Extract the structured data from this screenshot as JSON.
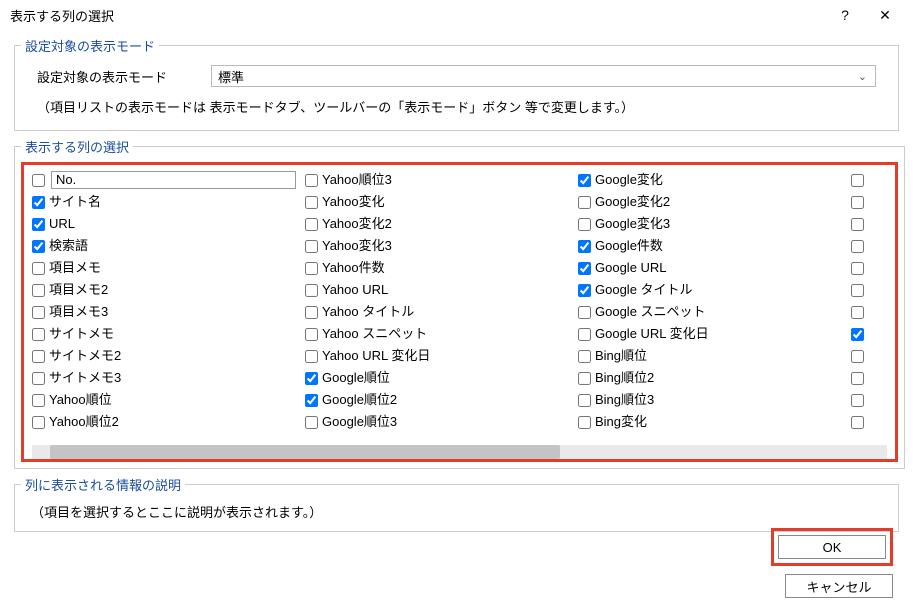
{
  "titlebar": {
    "title": "表示する列の選択",
    "help_icon": "?",
    "close_icon": "✕"
  },
  "mode_group": {
    "legend": "設定対象の表示モード",
    "label": "設定対象の表示モード",
    "selected_value": "標準",
    "note": "（項目リストの表示モードは 表示モードタブ、ツールバーの「表示モード」ボタン 等で変更します。）"
  },
  "cols_group": {
    "legend": "表示する列の選択",
    "columns": [
      [
        {
          "label": "No.",
          "checked": false,
          "editable": true
        },
        {
          "label": "サイト名",
          "checked": true
        },
        {
          "label": "URL",
          "checked": true
        },
        {
          "label": "検索語",
          "checked": true
        },
        {
          "label": "項目メモ",
          "checked": false
        },
        {
          "label": "項目メモ2",
          "checked": false
        },
        {
          "label": "項目メモ3",
          "checked": false
        },
        {
          "label": "サイトメモ",
          "checked": false
        },
        {
          "label": "サイトメモ2",
          "checked": false
        },
        {
          "label": "サイトメモ3",
          "checked": false
        },
        {
          "label": "Yahoo順位",
          "checked": false
        },
        {
          "label": "Yahoo順位2",
          "checked": false
        }
      ],
      [
        {
          "label": "Yahoo順位3",
          "checked": false
        },
        {
          "label": "Yahoo変化",
          "checked": false
        },
        {
          "label": "Yahoo変化2",
          "checked": false
        },
        {
          "label": "Yahoo変化3",
          "checked": false
        },
        {
          "label": "Yahoo件数",
          "checked": false
        },
        {
          "label": "Yahoo URL",
          "checked": false
        },
        {
          "label": "Yahoo タイトル",
          "checked": false
        },
        {
          "label": "Yahoo スニペット",
          "checked": false
        },
        {
          "label": "Yahoo URL 変化日",
          "checked": false
        },
        {
          "label": "Google順位",
          "checked": true
        },
        {
          "label": "Google順位2",
          "checked": true
        },
        {
          "label": "Google順位3",
          "checked": false
        }
      ],
      [
        {
          "label": "Google変化",
          "checked": true
        },
        {
          "label": "Google変化2",
          "checked": false
        },
        {
          "label": "Google変化3",
          "checked": false
        },
        {
          "label": "Google件数",
          "checked": true
        },
        {
          "label": "Google URL",
          "checked": true
        },
        {
          "label": "Google タイトル",
          "checked": true
        },
        {
          "label": "Google スニペット",
          "checked": false
        },
        {
          "label": "Google URL 変化日",
          "checked": false
        },
        {
          "label": "Bing順位",
          "checked": false
        },
        {
          "label": "Bing順位2",
          "checked": false
        },
        {
          "label": "Bing順位3",
          "checked": false
        },
        {
          "label": "Bing変化",
          "checked": false
        }
      ],
      [
        {
          "label": "",
          "checked": false
        },
        {
          "label": "",
          "checked": false
        },
        {
          "label": "",
          "checked": false
        },
        {
          "label": "",
          "checked": false
        },
        {
          "label": "",
          "checked": false
        },
        {
          "label": "",
          "checked": false
        },
        {
          "label": "",
          "checked": false
        },
        {
          "label": "",
          "checked": true
        },
        {
          "label": "",
          "checked": false
        },
        {
          "label": "",
          "checked": false
        },
        {
          "label": "",
          "checked": false
        },
        {
          "label": "",
          "checked": false
        }
      ]
    ]
  },
  "info_group": {
    "legend": "列に表示される情報の説明",
    "placeholder": "（項目を選択するとここに説明が表示されます。）"
  },
  "buttons": {
    "ok": "OK",
    "cancel": "キャンセル"
  }
}
